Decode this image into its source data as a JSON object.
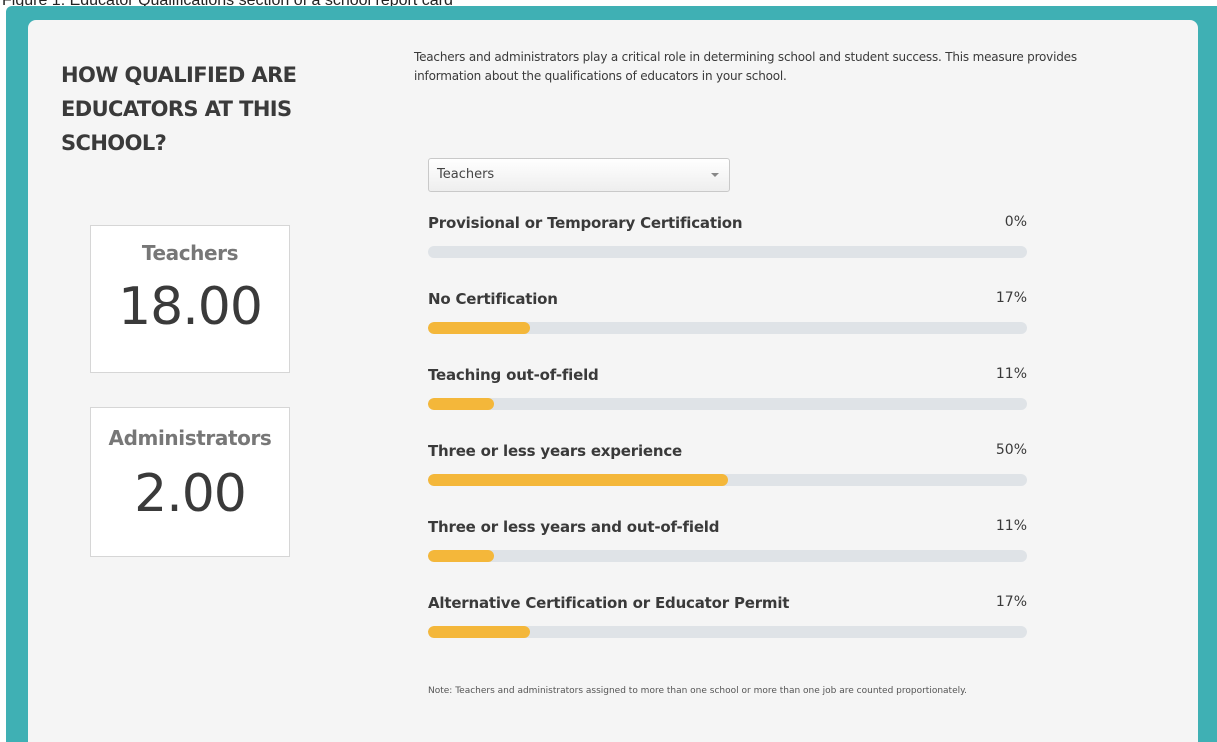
{
  "header_caption": "Figure 1: Educator Qualifications section of a school report card",
  "section": {
    "heading": "HOW QUALIFIED ARE EDUCATORS AT THIS SCHOOL?",
    "intro": "Teachers and administrators play a critical role in determining school and student success. This measure provides information about the qualifications of educators in your school."
  },
  "stats": {
    "teachers": {
      "label": "Teachers",
      "value": "18.00"
    },
    "administrators": {
      "label": "Administrators",
      "value": "2.00"
    }
  },
  "select": {
    "selected": "Teachers"
  },
  "chart_data": {
    "type": "bar",
    "orientation": "horizontal",
    "categories": [
      "Provisional or Temporary Certification",
      "No Certification",
      "Teaching out-of-field",
      "Three or less years experience",
      "Three or less years and out-of-field",
      "Alternative Certification or Educator Permit"
    ],
    "values": [
      0,
      17,
      11,
      50,
      11,
      17
    ],
    "value_labels": [
      "0%",
      "17%",
      "11%",
      "50%",
      "11%",
      "17%"
    ],
    "xlim": [
      0,
      100
    ],
    "colors": {
      "fill": "#f4b73a",
      "track": "#dfe3e7"
    }
  },
  "note": "Note: Teachers and administrators assigned to more than one school or more than one job are counted proportionately.",
  "colors": {
    "frame": "#3fb0b4",
    "panel": "#f5f5f5",
    "accent": "#f4b73a"
  },
  "icons": {
    "dropdown": "chevron-down-icon"
  }
}
